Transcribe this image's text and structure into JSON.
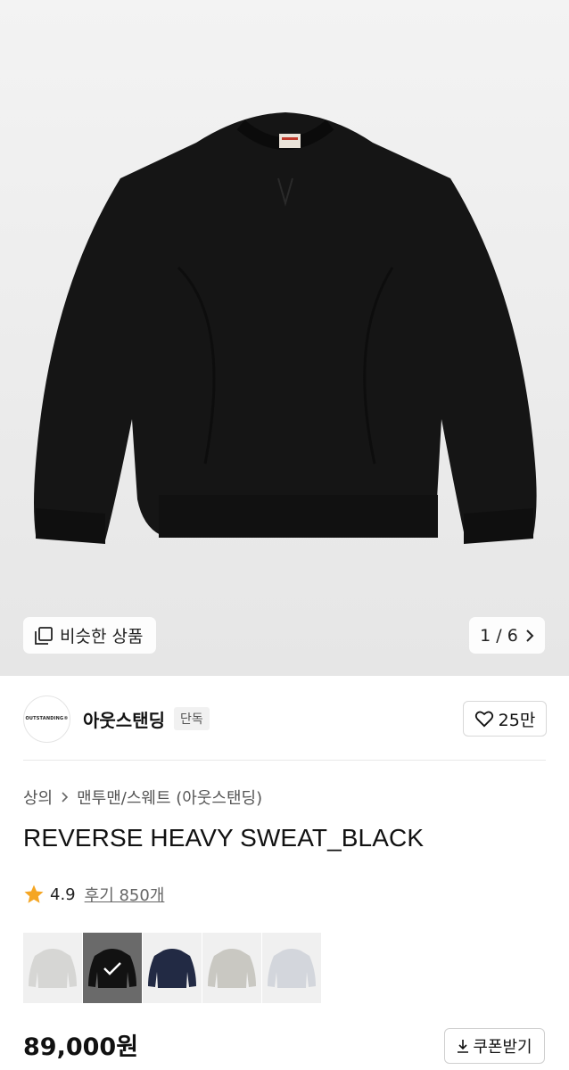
{
  "gallery": {
    "similar_label": "비슷한 상품",
    "page_current": "1",
    "page_separator": "/",
    "page_total": "6"
  },
  "brand": {
    "logo_text": "OUTSTANDING®",
    "name": "아웃스탠딩",
    "exclusive_badge": "단독",
    "like_count": "25만"
  },
  "breadcrumb": {
    "category": "상의",
    "subcategory": "맨투맨/스웨트 (아웃스탠딩)"
  },
  "product": {
    "title": "REVERSE HEAVY SWEAT_BLACK",
    "rating": "4.9",
    "reviews_label": "후기 850개",
    "price": "89,000원",
    "coupon_label": "쿠폰받기"
  },
  "swatches": [
    {
      "color": "#d6d6d4",
      "selected": false
    },
    {
      "color": "#121212",
      "selected": true
    },
    {
      "color": "#222a44",
      "selected": false
    },
    {
      "color": "#c9c8c2",
      "selected": false
    },
    {
      "color": "#d3d6dc",
      "selected": false
    }
  ],
  "colors": {
    "star": "#f5a623"
  }
}
